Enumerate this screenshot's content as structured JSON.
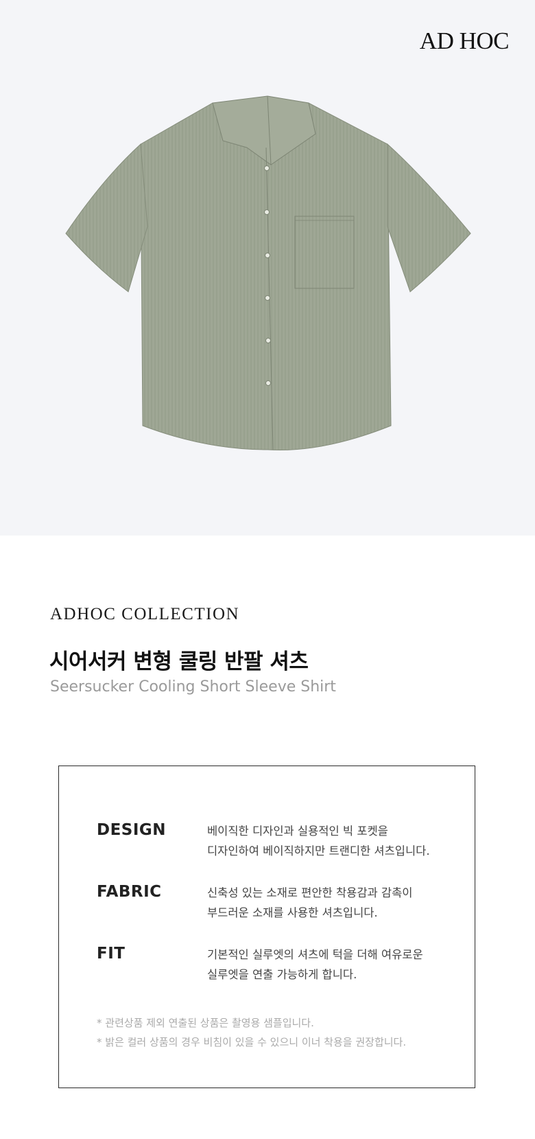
{
  "brand": {
    "logo_text": "AD HOC"
  },
  "product": {
    "image_alt": "Seersucker Cooling Short Sleeve Shirt",
    "color": "#a0a896"
  },
  "collection_label": "ADHOC COLLECTION",
  "title_ko": "시어서커 변형 쿨링 반팔 셔츠",
  "title_en": "Seersucker Cooling Short Sleeve Shirt",
  "specs": [
    {
      "label": "DESIGN",
      "lines": [
        "베이직한 디자인과 실용적인 빅 포켓을",
        "디자인하여 베이직하지만 트랜디한 셔츠입니다."
      ]
    },
    {
      "label": "FABRIC",
      "lines": [
        "신축성 있는 소재로 편안한 착용감과 감촉이",
        "부드러운 소재를 사용한 셔츠입니다."
      ]
    },
    {
      "label": "FIT",
      "lines": [
        "기본적인 실루엣의 셔츠에 턱을 더해 여유로운",
        "실루엣을 연출 가능하게 합니다."
      ]
    }
  ],
  "notes": [
    "* 관련상품 제외 연출된 상품은 촬영용 샘플입니다.",
    "* 밝은 컬러 상품의 경우 비침이 있을 수 있으니 이너 착용을 권장합니다."
  ]
}
